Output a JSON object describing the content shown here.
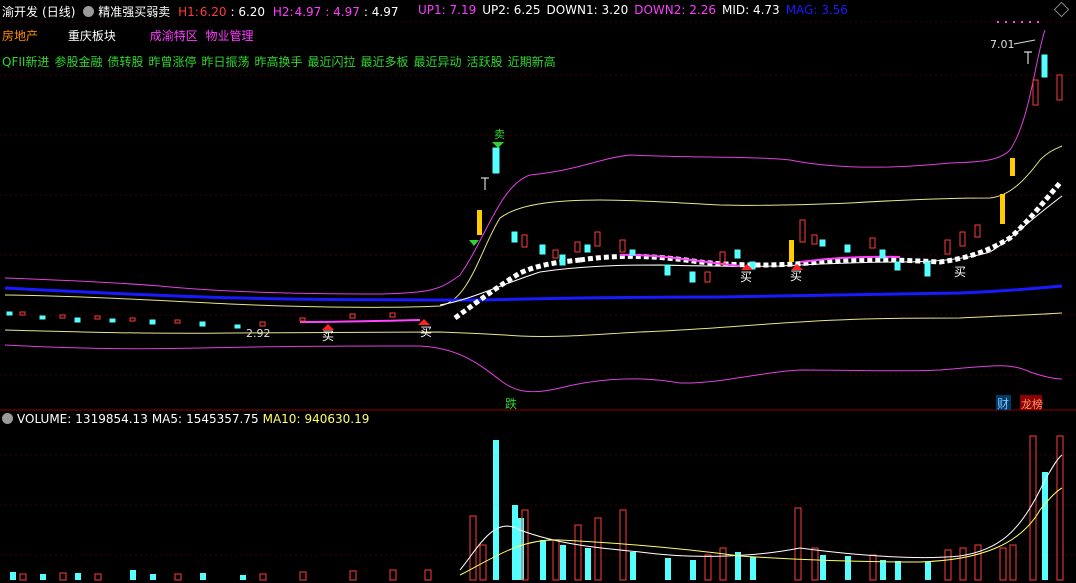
{
  "header": {
    "stock_name": "渝开发",
    "period": "(日线)",
    "indicator": "精准强买弱卖",
    "h1_label": "H1:",
    "h1_value": "6.20",
    "h1_value2": ": 6.20",
    "h2_label": "H2:",
    "h2_value": "4.97",
    "h2_value2": ": 4.97",
    "h2_value3": ": 4.97",
    "up1": "UP1: 7.19",
    "up2": "UP2: 6.25",
    "down1": "DOWN1: 3.20",
    "down2": "DOWN2: 2.26",
    "mid": "MID: 4.73",
    "mag": "MAG: 3.56"
  },
  "concepts": {
    "industry": "房地产",
    "region": "重庆板块",
    "concept1": "成渝特区",
    "concept2": "物业管理"
  },
  "tags": [
    "QFII新进",
    "参股金融",
    "债转股",
    "昨曾涨停",
    "昨日振荡",
    "昨高换手",
    "最近闪拉",
    "最近多板",
    "最近异动",
    "活跃股",
    "近期新高"
  ],
  "price_chart": {
    "high_label": "7.01",
    "low_label": "2.92",
    "signals": {
      "buy": "买",
      "sell": "卖",
      "fall": "跌",
      "finance": "财",
      "dragon": "龙榜"
    }
  },
  "volume": {
    "volume_label": "VOLUME:",
    "volume_value": "1319854.13",
    "ma5_label": "MA5:",
    "ma5_value": "1545357.75",
    "ma10_label": "MA10:",
    "ma10_value": "940630.19"
  },
  "colors": {
    "up": "#ff3b3b",
    "down": "#54ffff",
    "ma_white": "#ffffff",
    "ma_yellow": "#ffff66",
    "band_magenta": "#e040e0",
    "mag_blue": "#1a1aff",
    "tag_green": "#2fd52f"
  }
}
